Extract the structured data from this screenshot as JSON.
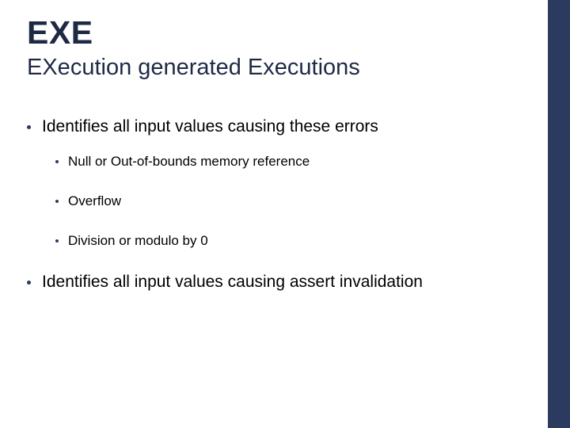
{
  "title": "EXE",
  "subtitle": "EXecution generated Executions",
  "bullets": [
    {
      "text": "Identifies all input values causing these errors",
      "children": [
        {
          "text": "Null or Out-of-bounds memory reference"
        },
        {
          "text": "Overflow"
        },
        {
          "text": "Division or modulo by 0"
        }
      ]
    },
    {
      "text": "Identifies all input values causing assert invalidation",
      "children": []
    }
  ]
}
